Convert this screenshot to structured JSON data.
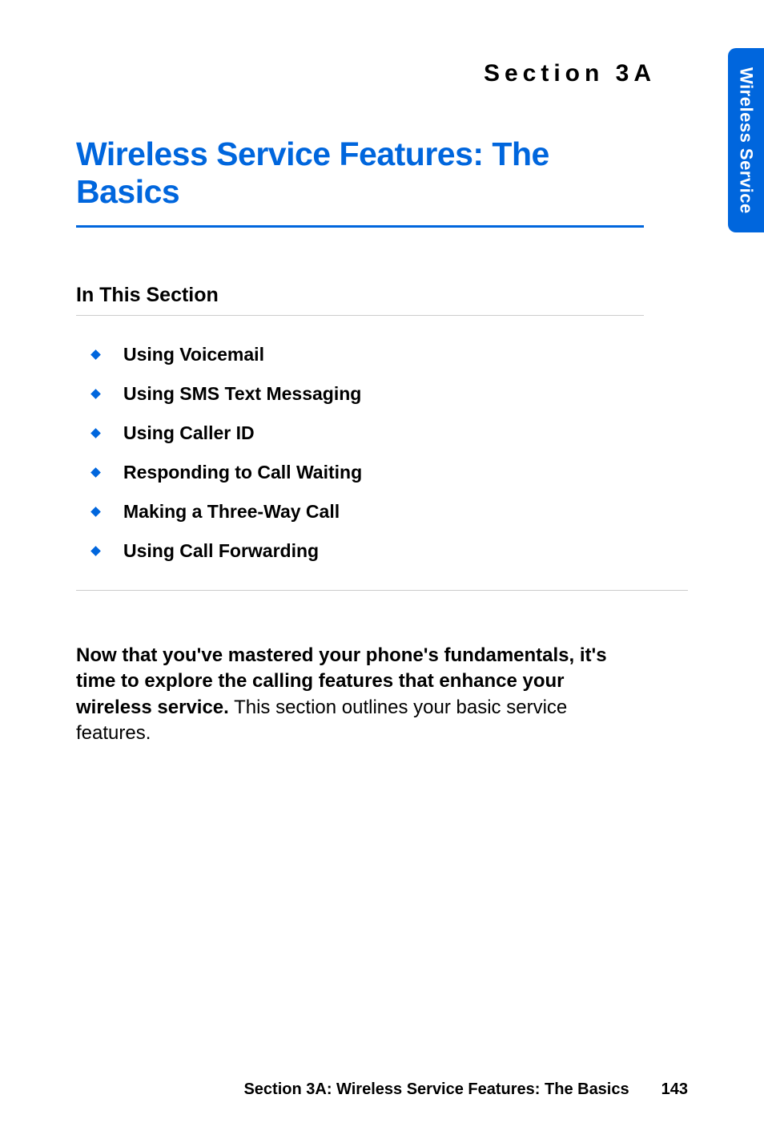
{
  "section_label": "Section 3A",
  "page_title": "Wireless Service Features: The Basics",
  "subsection_title": "In This Section",
  "bullets": [
    "Using Voicemail",
    "Using SMS Text Messaging",
    "Using Caller ID",
    "Responding to Call Waiting",
    "Making a Three-Way Call",
    "Using Call Forwarding"
  ],
  "body_bold": "Now that you've mastered your phone's fundamentals, it's time to explore the calling features that enhance your wireless service.",
  "body_regular": " This section outlines your basic service features.",
  "side_tab": "Wireless Service",
  "footer_title": "Section 3A: Wireless Service Features: The Basics",
  "footer_page": "143"
}
